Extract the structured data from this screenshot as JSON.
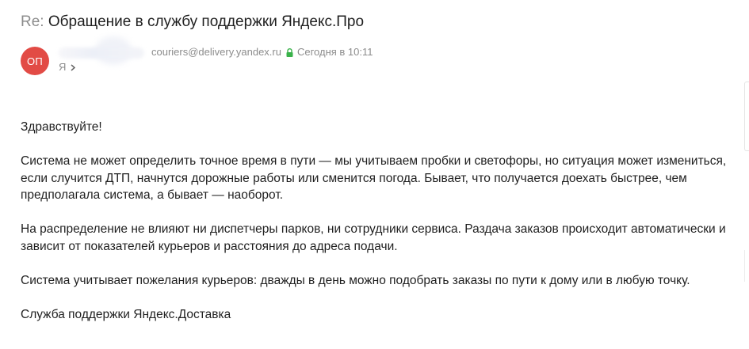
{
  "subject": {
    "prefix": "Re:",
    "title": "Обращение в службу поддержки Яндекс.Про"
  },
  "sender": {
    "avatar_initials": "ОП",
    "avatar_color": "#e24b45",
    "email": "couriers@delivery.yandex.ru",
    "date": "Сегодня в 10:11",
    "lock_icon": "lock-icon",
    "lock_color": "#3ab24a"
  },
  "recipient": {
    "label": "Я",
    "chevron_icon": "chevron-right-icon"
  },
  "body": {
    "greeting": "Здравствуйте!",
    "paragraph_1": "Система не может определить точное время в пути — мы учитываем пробки и светофоры, но ситуация может измениться, если случится ДТП, начнутся дорожные работы или сменится погода. Бывает, что получается доехать быстрее, чем предполагала система, а бывает — наоборот.",
    "paragraph_2": "На распределение не влияют ни диспетчеры парков, ни сотрудники сервиса. Раздача заказов происходит автоматически и зависит от показателей курьеров и расстояния до адреса подачи.",
    "paragraph_3": "Система учитывает пожелания курьеров: дважды в день можно подобрать заказы по пути к дому или в любую точку.",
    "signature": "Служба поддержки Яндекс.Доставка"
  }
}
